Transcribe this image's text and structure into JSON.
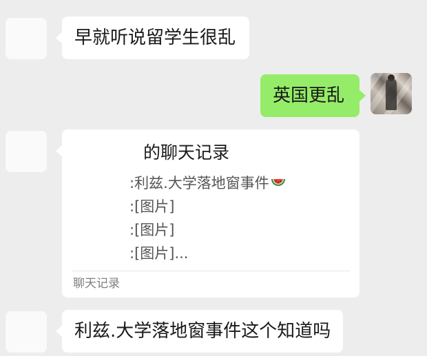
{
  "messages": [
    {
      "sender": "other",
      "text": "早就听说留学生很乱"
    },
    {
      "sender": "me",
      "text": "英国更乱"
    },
    {
      "sender": "other",
      "type": "chat_history_card",
      "title": "的聊天记录",
      "lines": [
        ":利兹.大学落地窗事件",
        ":[图片]",
        ":[图片]",
        ":[图片]..."
      ],
      "emoji": "watermelon-emoji",
      "footer": "聊天记录"
    },
    {
      "sender": "other",
      "text": "利兹.大学落地窗事件这个知道吗"
    }
  ],
  "colors": {
    "background": "#ededed",
    "incoming_bubble": "#ffffff",
    "outgoing_bubble": "#95ec69",
    "card_secondary_text": "#555555",
    "card_footer_text": "#7f7f7f"
  }
}
